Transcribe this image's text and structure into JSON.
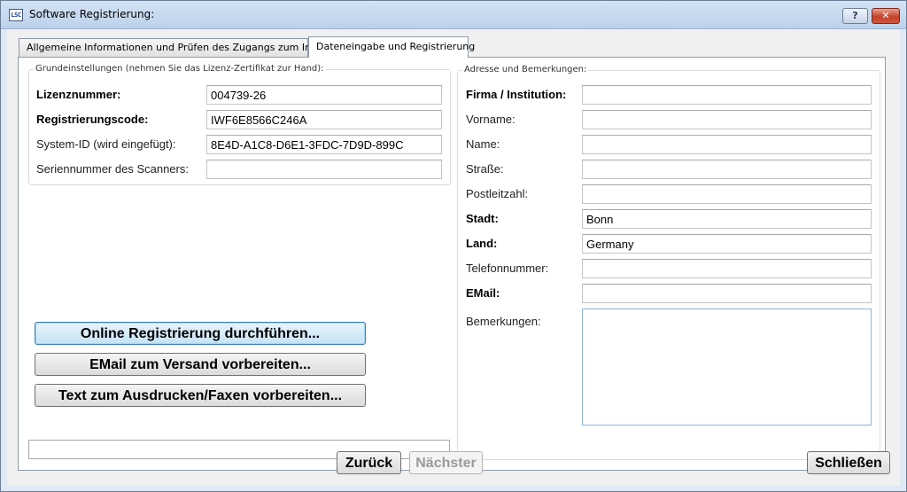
{
  "window": {
    "title": "Software Registrierung:",
    "help_label": "?",
    "close_label": "✕",
    "app_icon_text": "LSC"
  },
  "tabs": [
    {
      "label": "Allgemeine Informationen und Prüfen des Zugangs zum Internet",
      "active": false
    },
    {
      "label": "Dateneingabe und Registrierung",
      "active": true
    }
  ],
  "basic_settings": {
    "title": "Grundeinstellungen (nehmen Sie das Lizenz-Zertifikat zur Hand):",
    "fields": [
      {
        "label": "Lizenznummer:",
        "value": "004739-26",
        "bold": true
      },
      {
        "label": "Registrierungscode:",
        "value": "IWF6E8566C246A",
        "bold": true
      },
      {
        "label": "System-ID (wird eingefügt):",
        "value": "8E4D-A1C8-D6E1-3FDC-7D9D-899C",
        "bold": false
      },
      {
        "label": "Seriennummer des Scanners:",
        "value": "",
        "bold": false
      }
    ]
  },
  "address": {
    "title": "Adresse und Bemerkungen:",
    "fields": [
      {
        "label": "Firma / Institution:",
        "value": "",
        "bold": true
      },
      {
        "label": "Vorname:",
        "value": "",
        "bold": false
      },
      {
        "label": "Name:",
        "value": "",
        "bold": false
      },
      {
        "label": "Straße:",
        "value": "",
        "bold": false
      },
      {
        "label": "Postleitzahl:",
        "value": "",
        "bold": false
      },
      {
        "label": "Stadt:",
        "value": "Bonn",
        "bold": true
      },
      {
        "label": "Land:",
        "value": "Germany",
        "bold": true
      },
      {
        "label": "Telefonnummer:",
        "value": "",
        "bold": false
      },
      {
        "label": "EMail:",
        "value": "",
        "bold": true
      }
    ],
    "remarks_label": "Bemerkungen:",
    "remarks_value": ""
  },
  "actions": {
    "online_register": "Online Registrierung durchführen...",
    "email_prepare": "EMail zum Versand vorbereiten...",
    "print_fax_prepare": "Text zum Ausdrucken/Faxen vorbereiten...",
    "status_text": ""
  },
  "navigation": {
    "back": "Zurück",
    "next": "Nächster",
    "close": "Schließen"
  }
}
